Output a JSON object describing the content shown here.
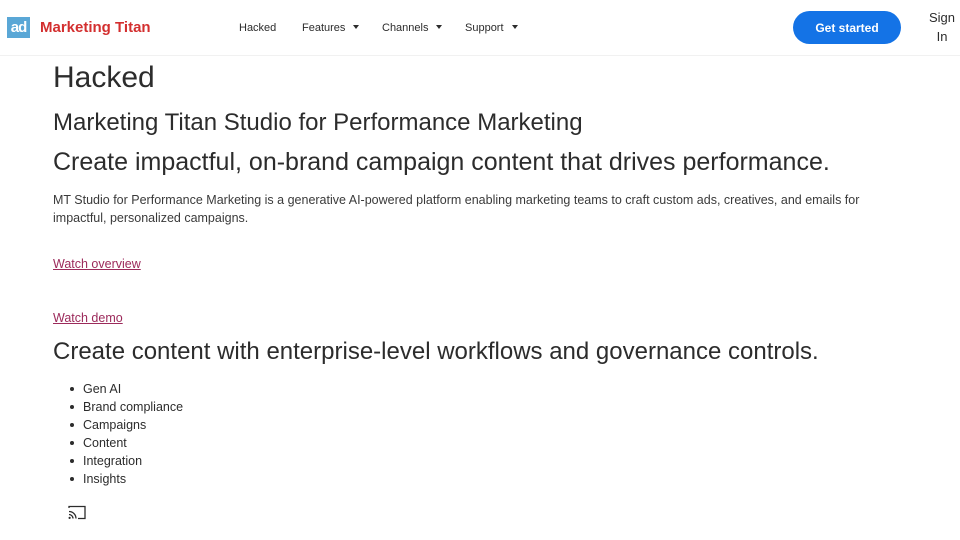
{
  "header": {
    "logo_mark": "ad",
    "brand": "Marketing Titan",
    "nav": [
      {
        "label": "Hacked",
        "dropdown": false
      },
      {
        "label": "Features",
        "dropdown": true
      },
      {
        "label": "Channels",
        "dropdown": true
      },
      {
        "label": "Support",
        "dropdown": true
      }
    ],
    "cta_label": "Get started",
    "signin_label": "Sign In"
  },
  "main": {
    "title": "Hacked",
    "subtitle": "Marketing Titan Studio for Performance Marketing",
    "headline": "Create impactful, on-brand campaign content that drives performance.",
    "description": "MT Studio for Performance Marketing is a generative   AI-powered platform enabling marketing teams to craft custom ads, creatives, and emails for impactful, personalized campaigns.",
    "watch_overview": "Watch overview",
    "watch_demo": "Watch demo",
    "section_heading": "Create content with enterprise-level workflows and governance controls.",
    "features": [
      "Gen AI",
      "Brand compliance",
      "Campaigns",
      "Content",
      "Integration",
      "Insights"
    ]
  },
  "icons": {
    "cast": "cast-icon",
    "caret": "caret-down-icon"
  },
  "colors": {
    "brand_red": "#d32f2f",
    "logo_blue": "#5aa7d6",
    "cta_blue": "#1473e6",
    "link": "#9c2a5b"
  }
}
